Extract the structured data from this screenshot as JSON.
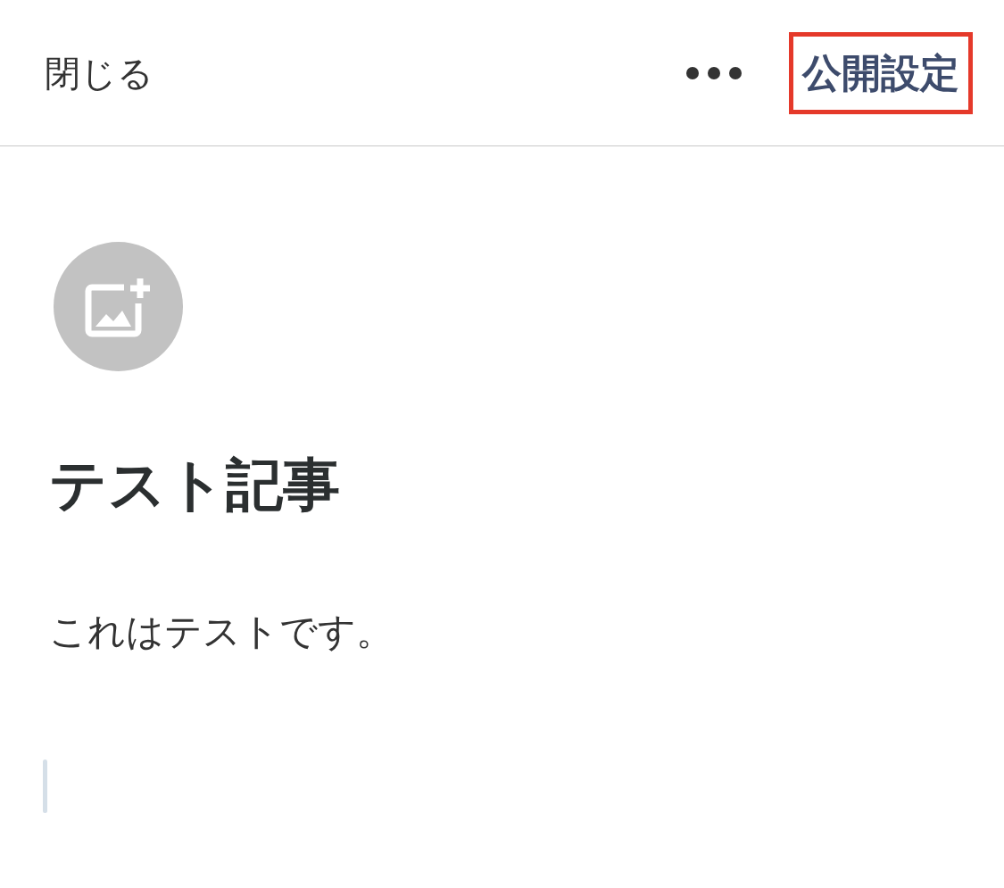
{
  "header": {
    "close": "閉じる",
    "publish": {
      "label": "公開設定",
      "highlighted": true
    }
  },
  "article": {
    "title": "テスト記事",
    "body": "これはテストです。"
  }
}
